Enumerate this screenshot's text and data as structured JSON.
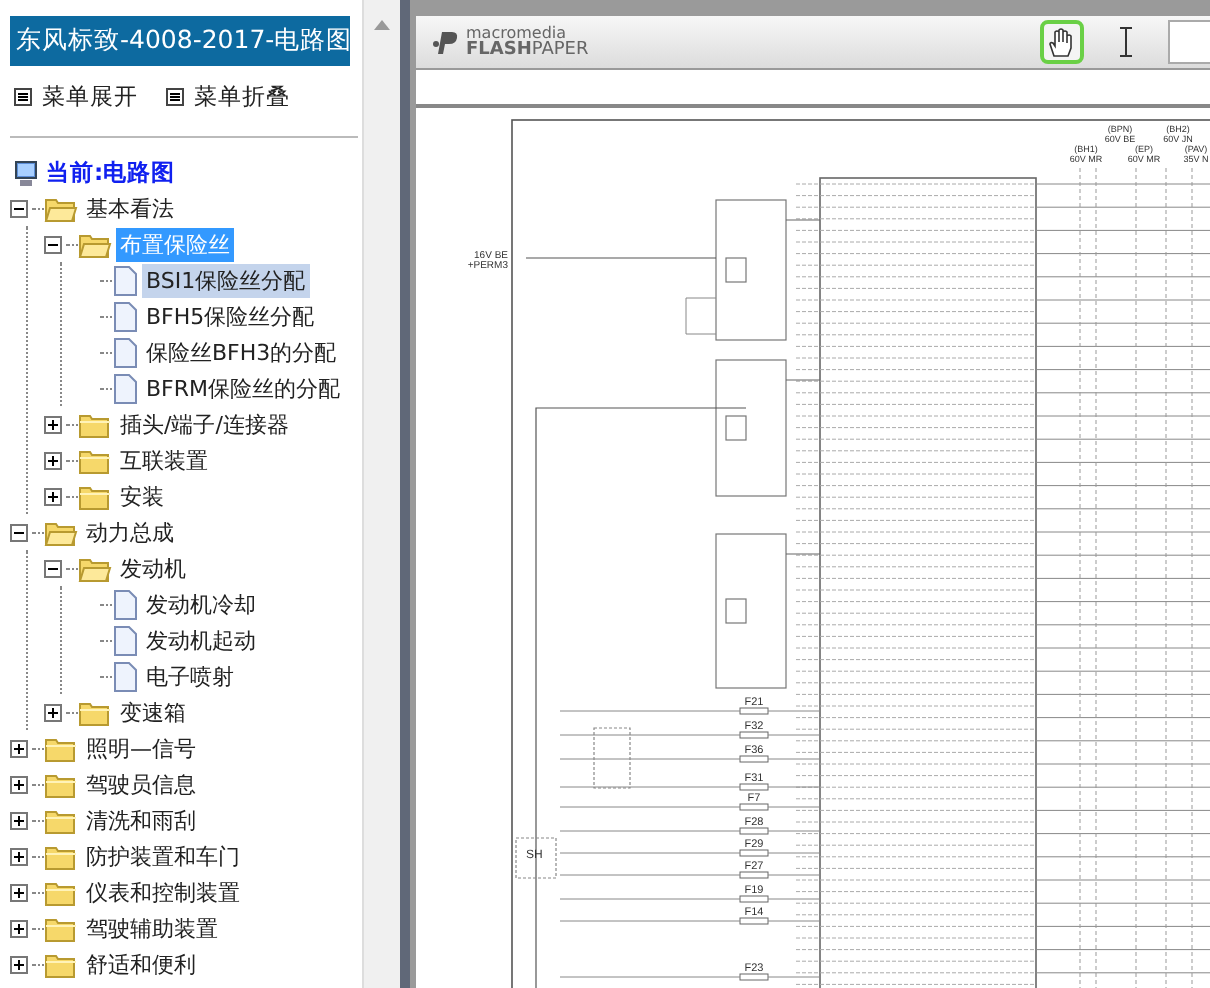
{
  "sidebar": {
    "title": "东风标致-4008-2017-电路图",
    "menu_buttons": [
      "菜单展开",
      "菜单折叠"
    ],
    "current": "当前:电路图",
    "tree": [
      {
        "label": "基本看法",
        "kind": "folder",
        "expanded": true,
        "selected": false,
        "children": [
          {
            "label": "布置保险丝",
            "kind": "folder",
            "expanded": true,
            "selected": true,
            "children": [
              {
                "label": "BSI1保险丝分配",
                "kind": "page",
                "selected": false,
                "current": true
              },
              {
                "label": "BFH5保险丝分配",
                "kind": "page",
                "selected": false,
                "current": false
              },
              {
                "label": "保险丝BFH3的分配",
                "kind": "page",
                "selected": false,
                "current": false
              },
              {
                "label": "BFRM保险丝的分配",
                "kind": "page",
                "selected": false,
                "current": false
              }
            ]
          },
          {
            "label": "插头/端子/连接器",
            "kind": "folder",
            "expanded": false,
            "selected": false
          },
          {
            "label": "互联装置",
            "kind": "folder",
            "expanded": false,
            "selected": false
          },
          {
            "label": "安装",
            "kind": "folder",
            "expanded": false,
            "selected": false
          }
        ]
      },
      {
        "label": "动力总成",
        "kind": "folder",
        "expanded": true,
        "selected": false,
        "children": [
          {
            "label": "发动机",
            "kind": "folder",
            "expanded": true,
            "selected": false,
            "children": [
              {
                "label": "发动机冷却",
                "kind": "page",
                "selected": false,
                "current": false
              },
              {
                "label": "发动机起动",
                "kind": "page",
                "selected": false,
                "current": false
              },
              {
                "label": "电子喷射",
                "kind": "page",
                "selected": false,
                "current": false
              }
            ]
          },
          {
            "label": "变速箱",
            "kind": "folder",
            "expanded": false,
            "selected": false
          }
        ]
      },
      {
        "label": "照明—信号",
        "kind": "folder",
        "expanded": false,
        "selected": false
      },
      {
        "label": "驾驶员信息",
        "kind": "folder",
        "expanded": false,
        "selected": false
      },
      {
        "label": "清洗和雨刮",
        "kind": "folder",
        "expanded": false,
        "selected": false
      },
      {
        "label": "防护装置和车门",
        "kind": "folder",
        "expanded": false,
        "selected": false
      },
      {
        "label": "仪表和控制装置",
        "kind": "folder",
        "expanded": false,
        "selected": false
      },
      {
        "label": "驾驶辅助装置",
        "kind": "folder",
        "expanded": false,
        "selected": false
      },
      {
        "label": "舒适和便利",
        "kind": "folder",
        "expanded": false,
        "selected": false
      }
    ]
  },
  "viewer": {
    "brand_top": "macromedia",
    "brand_bottom": "**FLASH**PAPER",
    "tools": [
      {
        "kind": "hand",
        "selected": true
      },
      {
        "kind": "text-select",
        "selected": false
      }
    ],
    "diagram": {
      "supply": [
        "16V BE",
        "+PERM3"
      ],
      "headers": [
        {
          "label": "(BPN)",
          "sub": "60V BE"
        },
        {
          "label": "(BH1)",
          "sub": "60V MR"
        },
        {
          "label": "(EP)",
          "sub": "60V MR"
        },
        {
          "label": "(BH2)",
          "sub": "60V JN"
        },
        {
          "label": "(PAV)",
          "sub": "35V N"
        }
      ],
      "relay": "SH",
      "fuses": [
        "F21",
        "F32",
        "F36",
        "F31",
        "F7",
        "F28",
        "F29",
        "F27",
        "F19",
        "F14",
        "F23"
      ]
    }
  }
}
